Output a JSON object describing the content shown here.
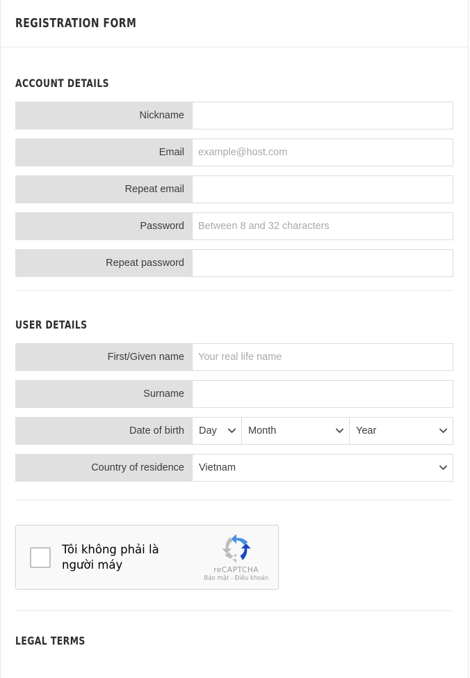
{
  "header": {
    "title": "Registration form"
  },
  "sections": {
    "account": {
      "heading": "Account details",
      "fields": [
        {
          "label": "Nickname",
          "placeholder": "",
          "value": ""
        },
        {
          "label": "Email",
          "placeholder": "example@host.com",
          "value": ""
        },
        {
          "label": "Repeat email",
          "placeholder": "",
          "value": ""
        },
        {
          "label": "Password",
          "placeholder": "Between 8 and 32 characters",
          "value": ""
        },
        {
          "label": "Repeat password",
          "placeholder": "",
          "value": ""
        }
      ]
    },
    "user": {
      "heading": "User details",
      "first_name": {
        "label": "First/Given name",
        "placeholder": "Your real life name",
        "value": ""
      },
      "surname": {
        "label": "Surname",
        "placeholder": "",
        "value": ""
      },
      "dob": {
        "label": "Date of birth",
        "day": "Day",
        "month": "Month",
        "year": "Year"
      },
      "country": {
        "label": "Country of residence",
        "selected": "Vietnam"
      }
    },
    "legal": {
      "heading": "Legal terms"
    }
  },
  "recaptcha": {
    "label": "Tôi không phải là người máy",
    "brand": "reCAPTCHA",
    "links": "Bảo mật - Điều khoản",
    "logo_colors": {
      "light_blue": "#4a90e2",
      "dark_blue": "#1c49bf",
      "grey": "#bdbdbd"
    }
  },
  "icons": {
    "chevron_down": "chevron-down-icon",
    "recaptcha_logo": "recaptcha-logo-icon"
  },
  "colors": {
    "label_bg": "#e0e0e0",
    "input_border": "#dcdcdc",
    "text": "#3c3c3c",
    "placeholder": "#a9a9a9",
    "divider": "#e8e8e8"
  }
}
